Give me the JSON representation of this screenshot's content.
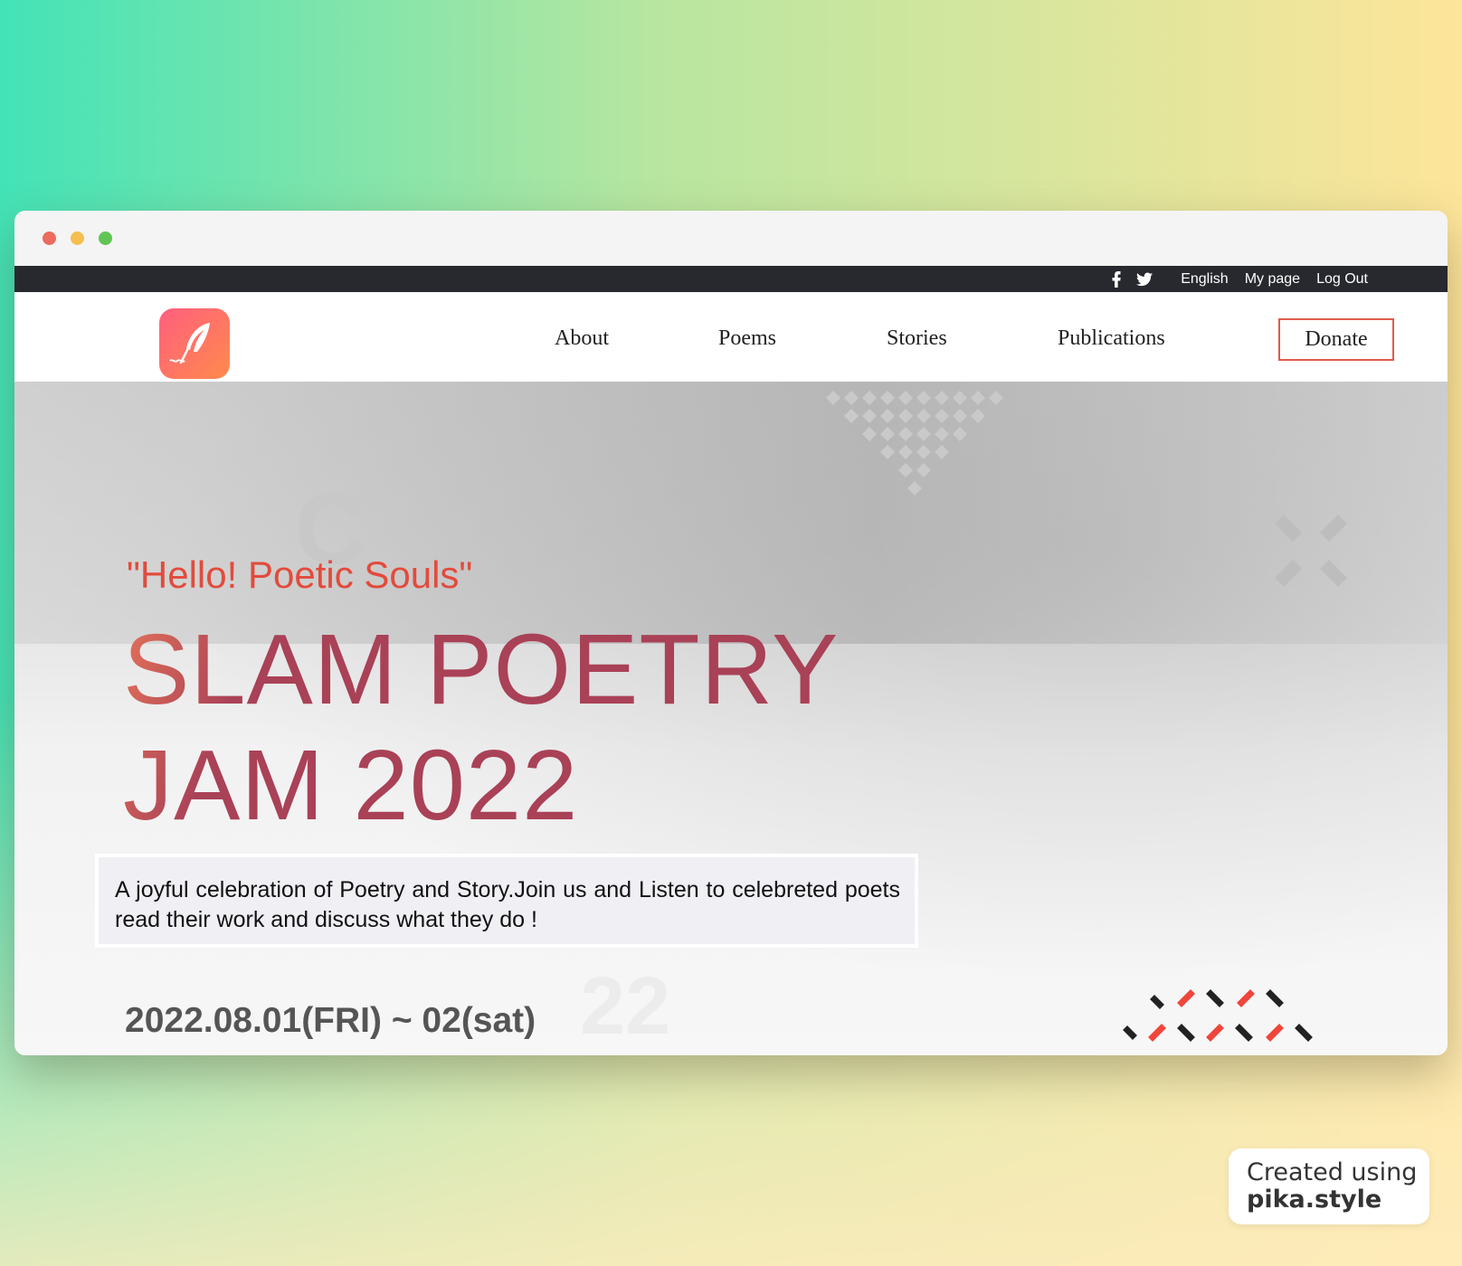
{
  "topbar": {
    "icons": [
      "facebook-icon",
      "twitter-icon"
    ],
    "language": "English",
    "mypage": "My page",
    "logout": "Log Out"
  },
  "nav": {
    "items": [
      "About",
      "Poems",
      "Stories",
      "Publications"
    ],
    "donate": "Donate"
  },
  "hero": {
    "greeting": "\"Hello! Poetic Souls\"",
    "title_line1": "SLAM POETRY",
    "title_line2": "JAM 2022",
    "description": "A joyful celebration of Poetry and Story.Join us and Listen to celebreted poets read their work and discuss what they do !",
    "date": "2022.08.01(FRI) ~ 02(sat)",
    "decor_letter": "C",
    "decor_number": "22"
  },
  "colors": {
    "accent": "#e24b3c",
    "title": "#a94157",
    "topbar_bg": "#27292e"
  },
  "watermark": {
    "line1": "Created using",
    "line2": "pika.style"
  }
}
